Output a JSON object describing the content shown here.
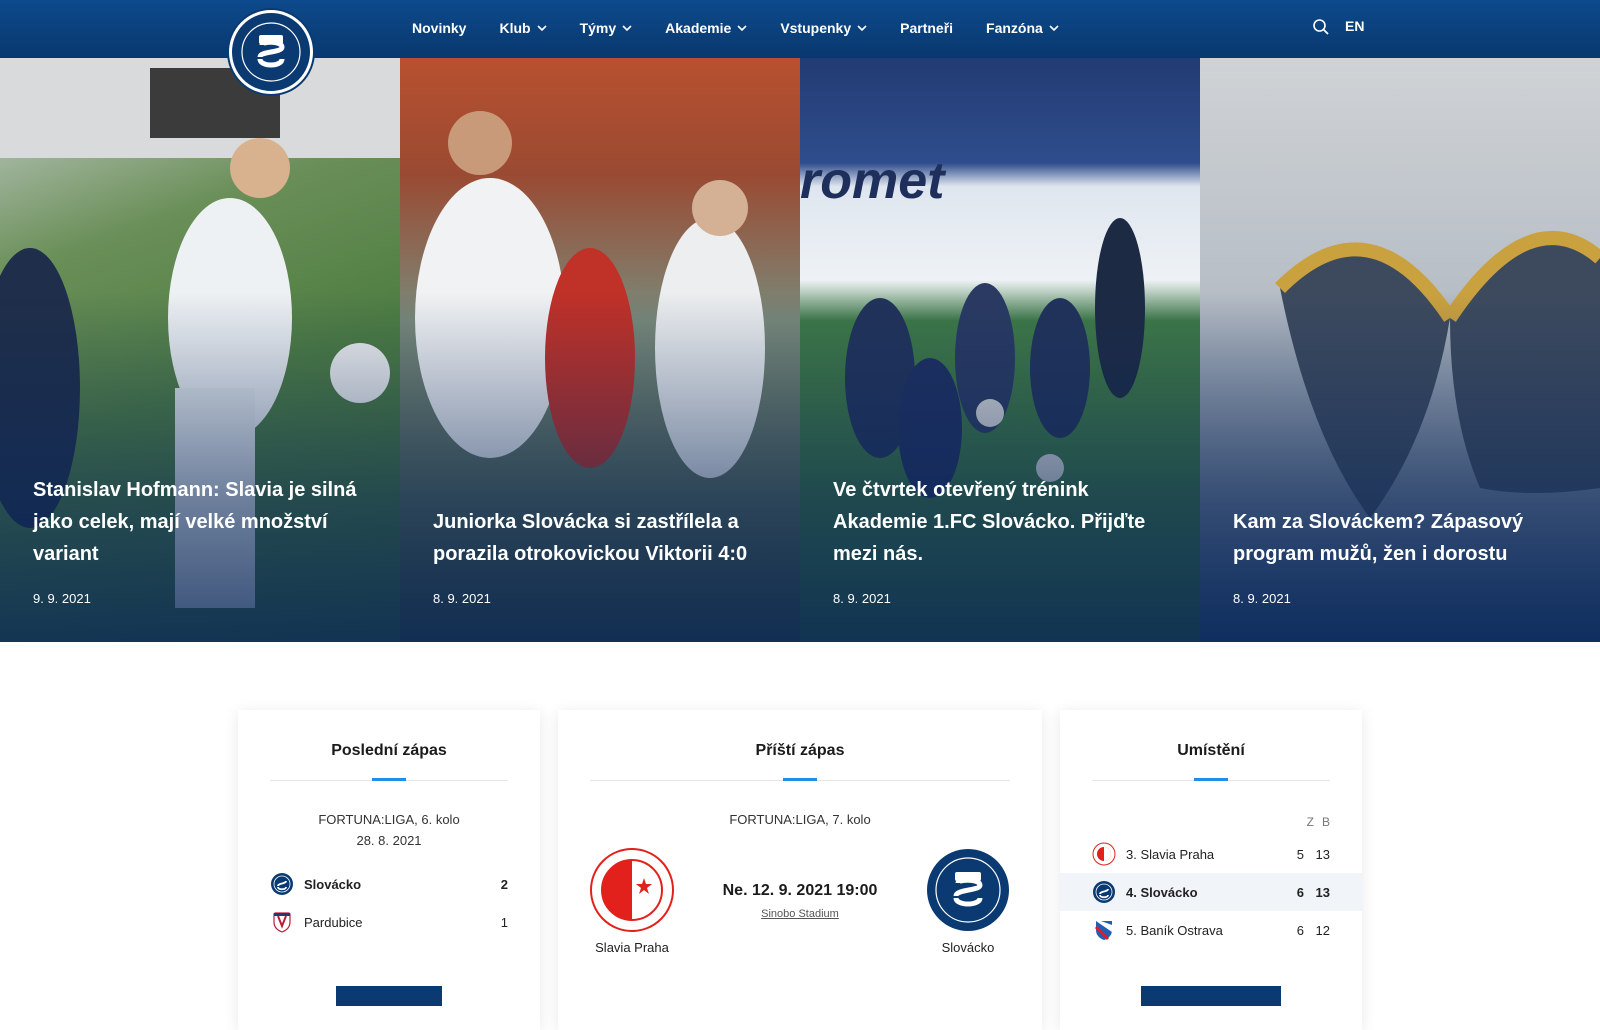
{
  "header": {
    "logo_text": "1.FC SLOVÁCKO",
    "nav": [
      {
        "label": "Novinky",
        "has_dropdown": false
      },
      {
        "label": "Klub",
        "has_dropdown": true
      },
      {
        "label": "Týmy",
        "has_dropdown": true
      },
      {
        "label": "Akademie",
        "has_dropdown": true
      },
      {
        "label": "Vstupenky",
        "has_dropdown": true
      },
      {
        "label": "Partneři",
        "has_dropdown": false
      },
      {
        "label": "Fanzóna",
        "has_dropdown": true
      }
    ],
    "lang": "EN"
  },
  "hero": [
    {
      "title": "Stanislav Hofmann: Slavia je silná jako celek, mají velké množství variant",
      "date": "9. 9. 2021"
    },
    {
      "title": "Juniorka Slovácka si zastřílela a porazila otrokovickou Viktorii 4:0",
      "date": "8. 9. 2021"
    },
    {
      "title": "Ve čtvrtek otevřený trénink Akademie 1.FC Slovácko. Přijďte mezi nás.",
      "date": "8. 9. 2021"
    },
    {
      "title": "Kam za Slováckem? Zápasový program mužů, žen i dorostu",
      "date": "8. 9. 2021"
    }
  ],
  "last_match": {
    "heading": "Poslední zápas",
    "competition": "FORTUNA:LIGA, 6. kolo",
    "date": "28. 8. 2021",
    "teams": [
      {
        "name": "Slovácko",
        "score": "2",
        "winner": true
      },
      {
        "name": "Pardubice",
        "score": "1",
        "winner": false
      }
    ]
  },
  "next_match": {
    "heading": "Příští zápas",
    "competition": "FORTUNA:LIGA, 7. kolo",
    "datetime": "Ne. 12. 9. 2021 19:00",
    "venue": "Sinobo Stadium",
    "home": "Slavia Praha",
    "away": "Slovácko"
  },
  "standings": {
    "heading": "Umístění",
    "col_z": "Z",
    "col_b": "B",
    "rows": [
      {
        "pos_name": "3. Slavia Praha",
        "z": "5",
        "b": "13",
        "highlight": false
      },
      {
        "pos_name": "4. Slovácko",
        "z": "6",
        "b": "13",
        "highlight": true
      },
      {
        "pos_name": "5. Baník Ostrava",
        "z": "6",
        "b": "12",
        "highlight": false
      }
    ]
  },
  "colors": {
    "primary": "#0b3a72",
    "accent": "#1e8ee6",
    "slavia_red": "#e2211c"
  }
}
